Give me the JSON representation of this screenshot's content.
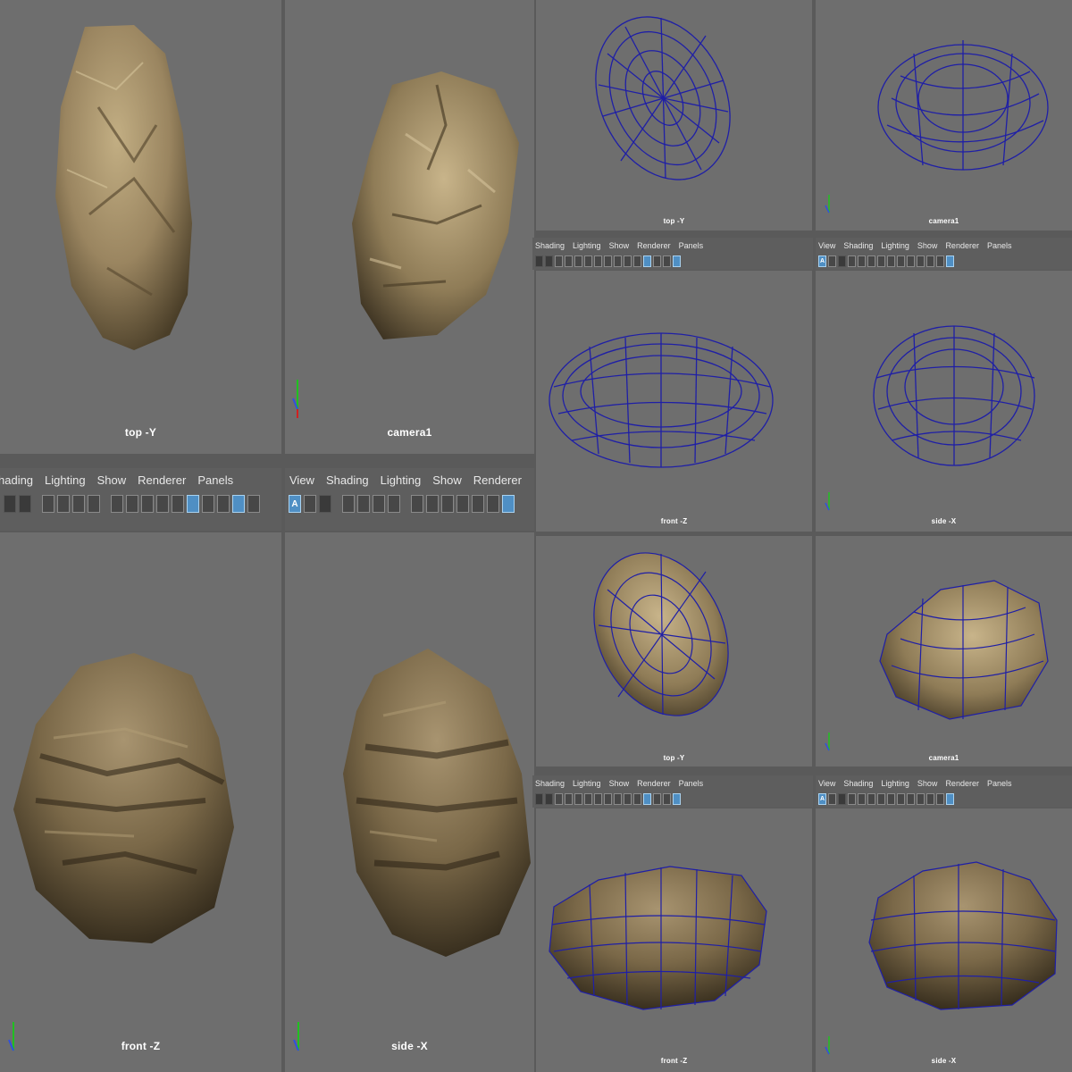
{
  "panel_menu": [
    "View",
    "Shading",
    "Lighting",
    "Show",
    "Renderer",
    "Panels"
  ],
  "panel_menu_cropped": [
    "hading",
    "Lighting",
    "Show",
    "Renderer",
    "Panels"
  ],
  "toolbar_select_label": "A",
  "left_composite": {
    "viewports": [
      {
        "id": "top",
        "label": "top -Y"
      },
      {
        "id": "camera",
        "label": "camera1"
      },
      {
        "id": "front",
        "label": "front -Z"
      },
      {
        "id": "side",
        "label": "side -X"
      }
    ]
  },
  "wireframe_composite": {
    "viewports": [
      {
        "id": "top",
        "label": "top -Y"
      },
      {
        "id": "camera",
        "label": "camera1"
      },
      {
        "id": "front",
        "label": "front -Z"
      },
      {
        "id": "side",
        "label": "side -X"
      }
    ]
  },
  "wireshaded_composite": {
    "viewports": [
      {
        "id": "top",
        "label": "top -Y"
      },
      {
        "id": "camera",
        "label": "camera1"
      },
      {
        "id": "front",
        "label": "front -Z"
      },
      {
        "id": "side",
        "label": "side -X"
      }
    ]
  },
  "axis_labels": {
    "x": "X",
    "y": "Y",
    "z": "Z"
  },
  "colors": {
    "viewport_bg": "#6e6e6e",
    "rock_base": "#8f7c57",
    "rock_dark": "#3d3322",
    "rock_light": "#c2ae83",
    "wireframe": "#1f1fa6",
    "axis_x": "#d02020",
    "axis_y": "#20c020",
    "axis_z": "#3050e0",
    "toolbar_selected": "#4f8fc4"
  }
}
